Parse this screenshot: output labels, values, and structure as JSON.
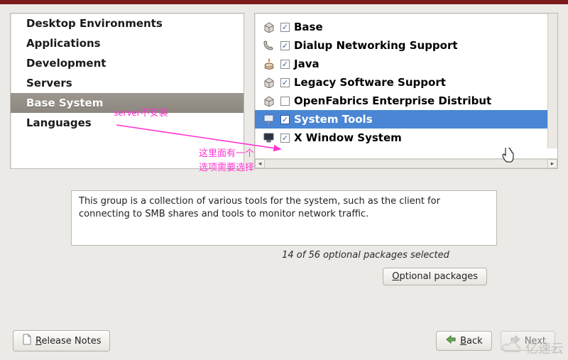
{
  "categories": [
    {
      "label": "Desktop Environments",
      "selected": false
    },
    {
      "label": "Applications",
      "selected": false
    },
    {
      "label": "Development",
      "selected": false
    },
    {
      "label": "Servers",
      "selected": false
    },
    {
      "label": "Base System",
      "selected": true
    },
    {
      "label": "Languages",
      "selected": false
    }
  ],
  "packages": [
    {
      "label": "Base",
      "checked": true,
      "selected": false,
      "icon": "box"
    },
    {
      "label": "Dialup Networking Support",
      "checked": true,
      "selected": false,
      "icon": "phone"
    },
    {
      "label": "Java",
      "checked": true,
      "selected": false,
      "icon": "java"
    },
    {
      "label": "Legacy Software Support",
      "checked": true,
      "selected": false,
      "icon": "box"
    },
    {
      "label": "OpenFabrics Enterprise Distribut",
      "checked": false,
      "selected": false,
      "icon": "box"
    },
    {
      "label": "System Tools",
      "checked": true,
      "selected": true,
      "icon": "monitor"
    },
    {
      "label": "X Window System",
      "checked": true,
      "selected": false,
      "icon": "monitor2"
    }
  ],
  "description": "This group is a collection of various tools for the system, such as the client for connecting to SMB shares and tools to monitor network traffic.",
  "status_text": "14 of 56 optional packages selected",
  "buttons": {
    "optional_packages": "Optional packages",
    "release_notes": "Release Notes",
    "back": "Back",
    "next": "Next"
  },
  "annotations": {
    "server_note": "server不安装",
    "selection_note_l1": "这里面有一个",
    "selection_note_l2": "选项需要选择"
  },
  "watermark": "亿速云"
}
